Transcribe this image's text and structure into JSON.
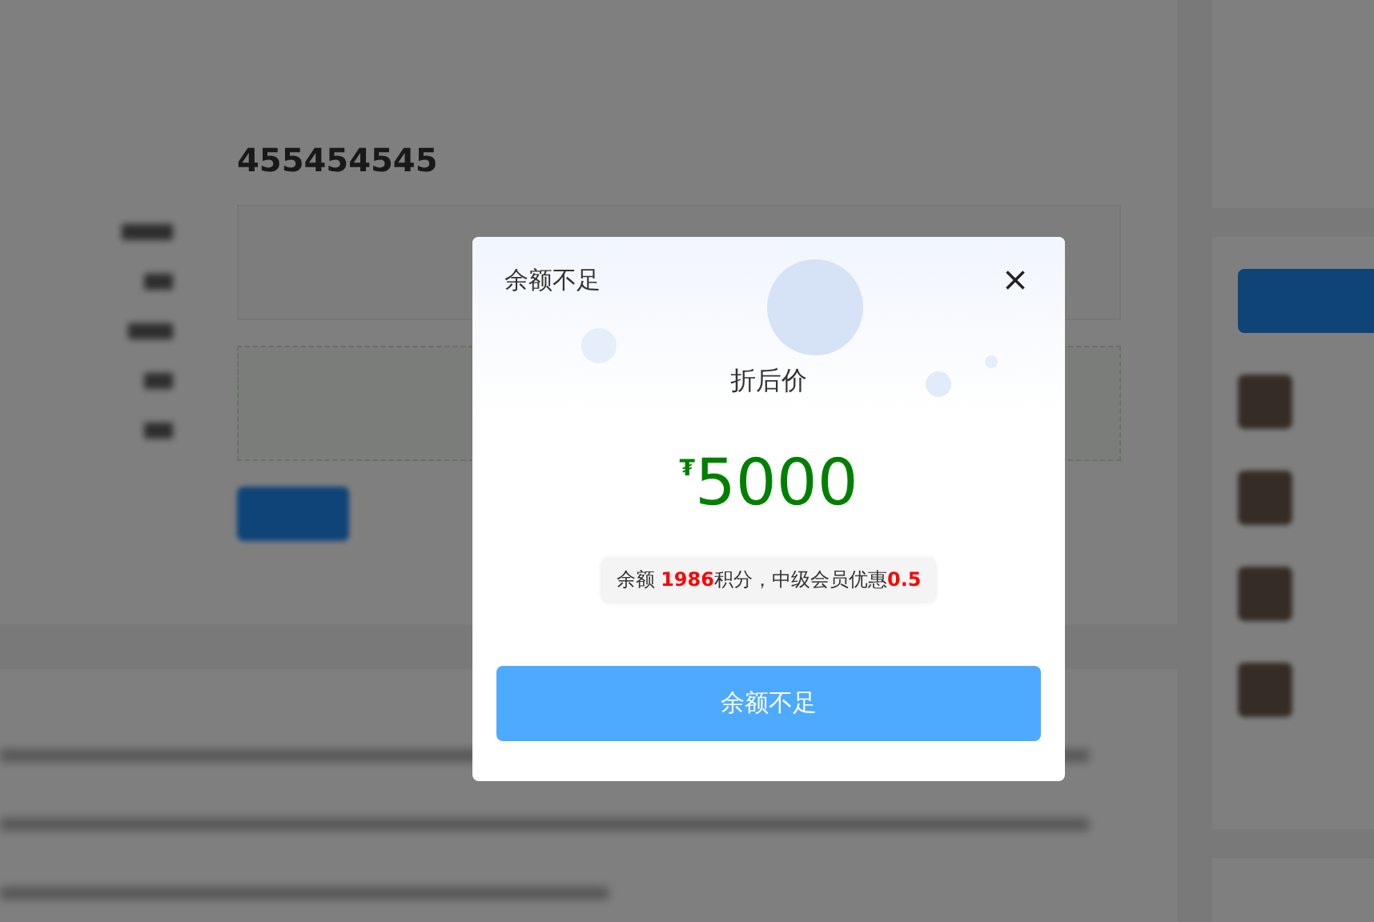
{
  "page": {
    "title": "455454545"
  },
  "dialog": {
    "title": "余额不足",
    "price_label": "折后价",
    "currency": "₮",
    "price": "5000",
    "note": "余额 **1986**积分，中级会员优惠**0.5**",
    "button": "余额不足"
  }
}
